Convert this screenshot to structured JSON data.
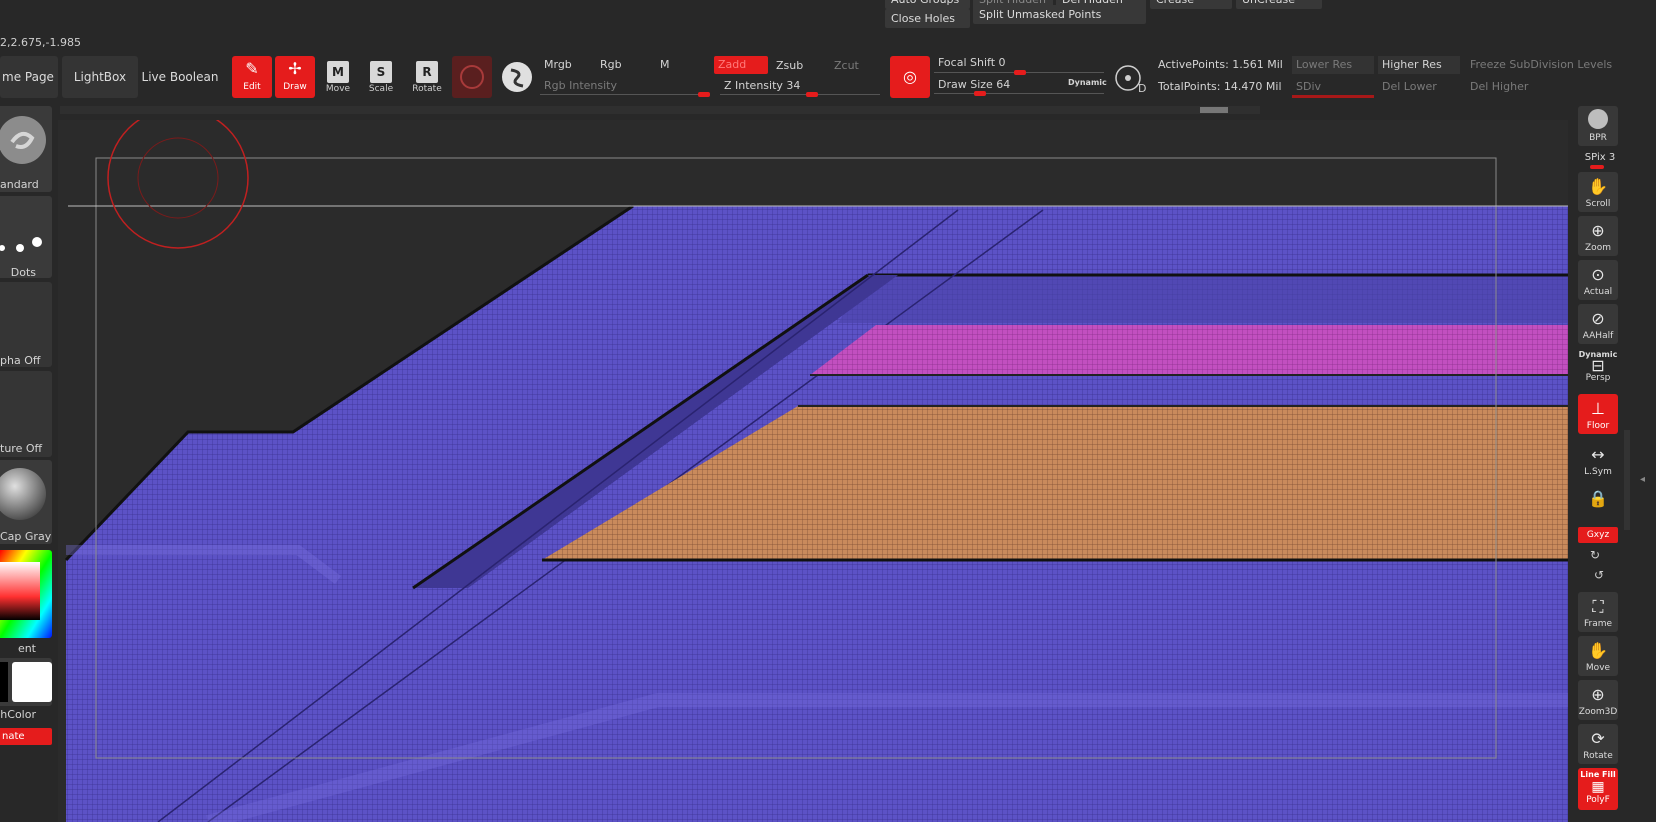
{
  "top_menu": {
    "auto_groups": "Auto Groups",
    "split_hidden": "Split Hidden",
    "del_hidden": "Del Hidden",
    "crease": "Crease",
    "uncrease": "UnCrease",
    "close_holes": "Close Holes",
    "split_unmasked": "Split Unmasked Points"
  },
  "coordinates": "2,2.675,-1.985",
  "toolbar": {
    "home_page": "me Page",
    "lightbox": "LightBox",
    "live_boolean": "Live Boolean",
    "tools": [
      {
        "label": "Edit",
        "icon": "edit-icon",
        "active": true
      },
      {
        "label": "Draw",
        "icon": "draw-icon",
        "active": true
      },
      {
        "label": "Move",
        "icon": "move-icon",
        "letter": "M"
      },
      {
        "label": "Scale",
        "icon": "scale-icon",
        "letter": "S"
      },
      {
        "label": "Rotate",
        "icon": "rotate-icon",
        "letter": "R"
      }
    ],
    "mrgb": "Mrgb",
    "rgb": "Rgb",
    "m": "M",
    "zadd": "Zadd",
    "zsub": "Zsub",
    "zcut": "Zcut",
    "rgb_intensity": "Rgb Intensity",
    "z_intensity": "Z Intensity 34",
    "focal_shift": "Focal Shift 0",
    "draw_size": "Draw Size 64",
    "dynamic": "Dynamic",
    "active_points": "ActivePoints: 1.561 Mil",
    "total_points": "TotalPoints: 14.470 Mil",
    "lower_res": "Lower Res",
    "higher_res": "Higher Res",
    "freeze_subdiv": "Freeze SubDivision Levels",
    "sdiv": "SDiv",
    "del_lower": "Del Lower",
    "del_higher": "Del Higher"
  },
  "left_panel": {
    "standard": "andard",
    "dots": "Dots",
    "alpha_off": "pha Off",
    "texture_off": "ture Off",
    "matcap_gray": "Cap Gray",
    "gradient": "ent",
    "switch_color": "hColor",
    "alternate": "nate"
  },
  "right_panel": {
    "bpr": "BPR",
    "spix": "SPix 3",
    "scroll": "Scroll",
    "zoom": "Zoom",
    "actual": "Actual",
    "aahalf": "AAHalf",
    "dynamic": "Dynamic",
    "persp": "Persp",
    "floor": "Floor",
    "lsym": "L.Sym",
    "xyz": "Gxyz",
    "frame": "Frame",
    "move": "Move",
    "zoom3d": "Zoom3D",
    "rotate": "Rotate",
    "line_fill": "Line Fill",
    "polyf": "PolyF"
  },
  "colors": {
    "accent": "#e51c1c",
    "mesh_purple": "#5a4fc8",
    "mesh_pink": "#c24fc0",
    "mesh_orange": "#c88a5c"
  }
}
